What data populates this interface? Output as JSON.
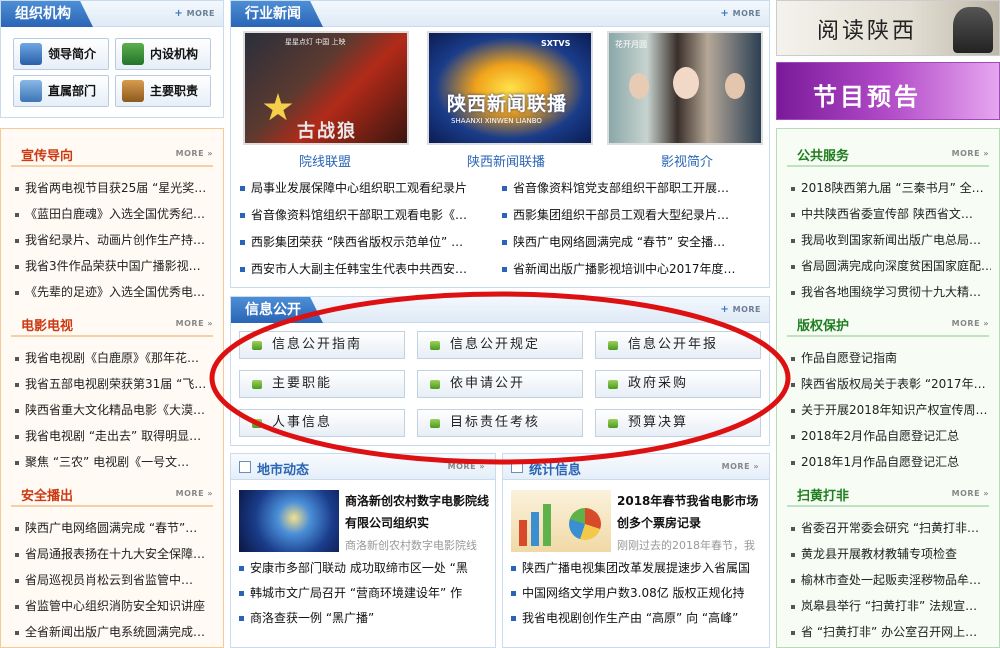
{
  "left_top": {
    "title": "组织机构",
    "more": "MORE",
    "buttons": [
      "领导简介",
      "内设机构",
      "直属部门",
      "主要职责"
    ]
  },
  "left_sections": [
    {
      "title": "宣传导向",
      "more": "MORE",
      "items": [
        "我省两电视节目获25届 “星光奖…",
        "《蓝田白鹿魂》入选全国优秀纪…",
        "我省纪录片、动画片创作生产持…",
        "我省3件作品荣获中国广播影视…",
        "《先辈的足迹》入选全国优秀电…"
      ]
    },
    {
      "title": "电影电视",
      "more": "MORE",
      "items": [
        "我省电视剧《白鹿原》《那年花…",
        "我省五部电视剧荣获第31届 “飞…",
        "陕西省重大文化精品电影《大漠…",
        "我省电视剧 “走出去” 取得明显…",
        "聚焦 “三农” 电视剧《一号文…"
      ]
    },
    {
      "title": "安全播出",
      "more": "MORE",
      "items": [
        "陕西广电网络圆满完成 “春节”…",
        "省局通报表扬在十九大安全保障…",
        "省局巡视员肖松云到省监管中…",
        "省监管中心组织消防安全知识讲座",
        "全省新闻出版广电系统圆满完成…"
      ]
    }
  ],
  "industry": {
    "title": "行业新闻",
    "more": "MORE",
    "images": [
      {
        "caption": "院线联盟",
        "overlay_top": "星星点灯   中国   上映",
        "overlay_big": "古战狼"
      },
      {
        "caption": "陕西新闻联播",
        "overlay_top": "SXTVS",
        "overlay_big": "陕西新闻联播",
        "overlay_sub": "SHAANXI  XINWEN  LIANBO"
      },
      {
        "caption": "影视简介",
        "overlay_top": "花开月圆"
      }
    ],
    "news": [
      [
        "局事业发展保障中心组织职工观看纪录片",
        "省音像资料馆党支部组织干部职工开展…"
      ],
      [
        "省音像资料馆组织干部职工观看电影《…",
        "西影集团组织干部员工观看大型纪录片…"
      ],
      [
        "西影集团荣获 “陕西省版权示范单位” …",
        "陕西广电网络圆满完成 “春节” 安全播…"
      ],
      [
        "西安市人大副主任韩宝生代表中共西安…",
        "省新闻出版广播影视培训中心2017年度…"
      ]
    ]
  },
  "info": {
    "title": "信息公开",
    "more": "MORE",
    "buttons": [
      "信息公开指南",
      "信息公开规定",
      "信息公开年报",
      "主要职能",
      "依申请公开",
      "政府采购",
      "人事信息",
      "目标责任考核",
      "预算决算"
    ]
  },
  "local": {
    "title": "地市动态",
    "more": "MORE",
    "feature_title": "商洛新创农村数字电影院线有限公司组织实",
    "feature_desc": "商洛新创农村数字电影院线",
    "items": [
      "安康市多部门联动 成功取缔市区一处 “黑",
      "韩城市文广局召开 “营商环境建设年” 作",
      "商洛查获一例 “黑广播”"
    ]
  },
  "stats": {
    "title": "统计信息",
    "more": "MORE",
    "feature_title": "2018年春节我省电影市场创多个票房记录",
    "feature_desc": "刚刚过去的2018年春节，我",
    "items": [
      "陕西广播电视集团改革发展提速步入省属国",
      "中国网络文学用户数3.08亿 版权正规化持",
      "我省电视剧创作生产由 “高原” 向 “高峰”"
    ]
  },
  "right_top": {
    "banner1": "阅读陕西",
    "banner2": "节目预告"
  },
  "right_sections": [
    {
      "title": "公共服务",
      "more": "MORE",
      "items": [
        "2018陕西第九届 “三秦书月” 全…",
        "中共陕西省委宣传部 陕西省文…",
        "我局收到国家新闻出版广电总局…",
        "省局圆满完成向深度贫困国家庭配…",
        "我省各地围绕学习贯彻十九大精…"
      ]
    },
    {
      "title": "版权保护",
      "more": "MORE",
      "items": [
        "作品自愿登记指南",
        "陕西省版权局关于表彰 “2017年…",
        "关于开展2018年知识产权宣传周…",
        "2018年2月作品自愿登记汇总",
        "2018年1月作品自愿登记汇总"
      ]
    },
    {
      "title": "扫黄打非",
      "more": "MORE",
      "items": [
        "省委召开常委会研究 “扫黄打非…",
        "黄龙县开展教材教辅专项检查",
        "榆林市查处一起贩卖淫秽物品牟…",
        "岚皋县举行 “扫黄打非” 法规宣…",
        "省 “扫黄打非” 办公室召开网上…"
      ]
    }
  ],
  "colors": {
    "blue": "#2a64b6",
    "orange": "#cc3a12",
    "green": "#1f7f1f",
    "ellipse": "#dd1111"
  }
}
